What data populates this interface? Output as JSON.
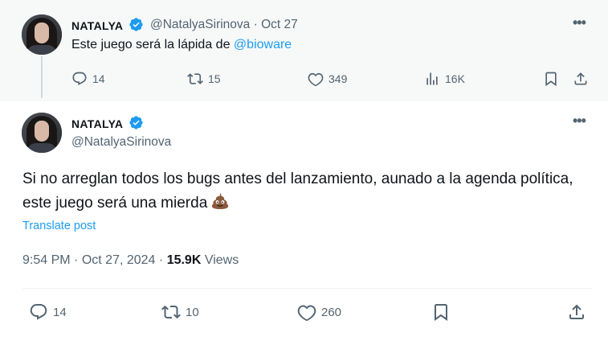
{
  "parent_tweet": {
    "display_name": "NATALYA",
    "handle": "@NatalyaSirinova",
    "separator": "·",
    "date": "Oct 27",
    "text_before": "Este juego será la lápida de ",
    "mention": "@bioware",
    "replies": "14",
    "reposts": "15",
    "likes": "349",
    "views": "16K"
  },
  "main_tweet": {
    "display_name": "NATALYA",
    "handle": "@NatalyaSirinova",
    "text": "Si no arreglan todos los bugs antes del lanzamiento, aunado a la agenda política, este juego será una mierda",
    "emoji": "pile-of-poo",
    "translate_label": "Translate post",
    "time": "9:54 PM",
    "date": "Oct 27, 2024",
    "dot": "·",
    "views_count": "15.9K",
    "views_label": "Views",
    "replies": "14",
    "reposts": "10",
    "likes": "260"
  },
  "colors": {
    "accent": "#1d9bf0",
    "muted": "#536471",
    "text": "#0f1419",
    "parent_bg": "#f7f9f9"
  }
}
